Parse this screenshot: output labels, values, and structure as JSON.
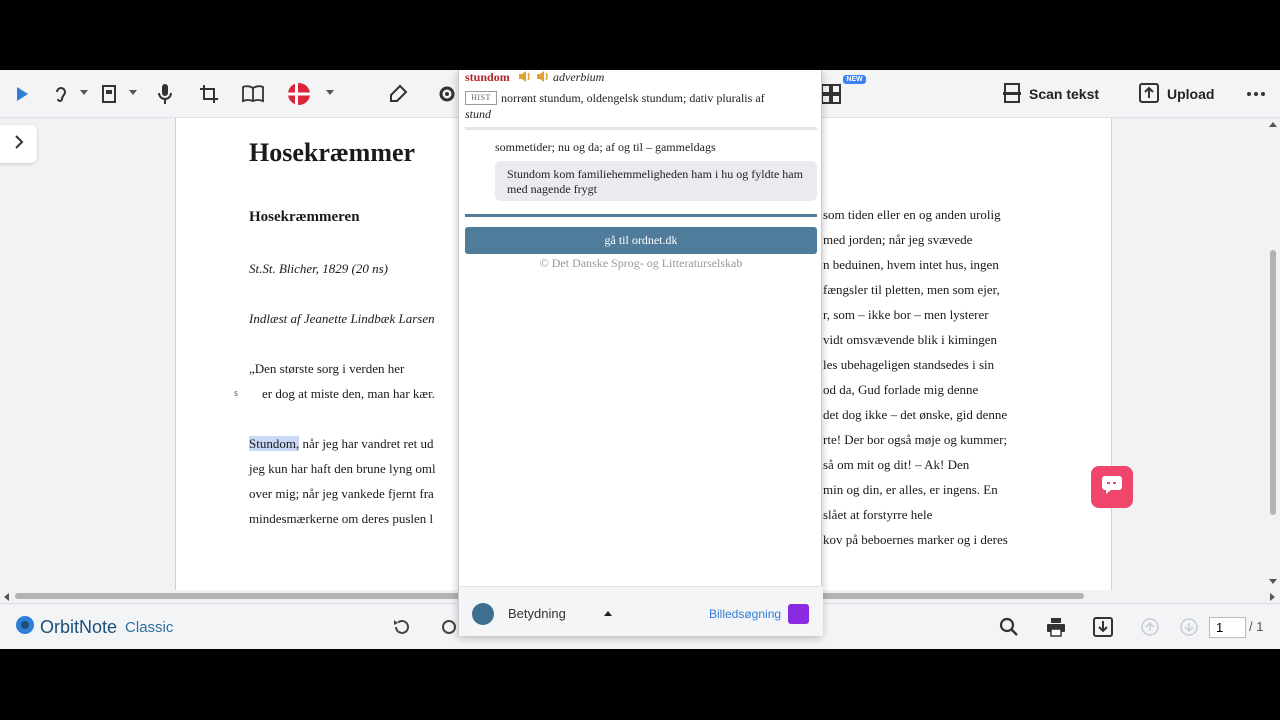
{
  "toolbar": {
    "scan_label": "Scan tekst",
    "upload_label": "Upload",
    "new_badge": "NEW"
  },
  "document": {
    "title": "Hosekræmmer",
    "subtitle": "Hosekræmmeren",
    "author_line": "St.St. Blicher, 1829 (20 ns)",
    "reader_line": "Indlæst af Jeanette Lindbæk Larsen",
    "quote_line1": "„Den største sorg i verden her",
    "quote_marker": "s",
    "quote_line2": "er dog at miste den, man har kær.",
    "highlighted_word": "Stundom,",
    "left_lines": [
      " når jeg har vandret ret ud",
      "jeg kun har haft den brune lyng oml",
      "over mig; når jeg vankede fjernt fra",
      "mindesmærkerne om deres puslen l"
    ],
    "right_lines": [
      "som tiden eller en og anden urolig",
      "med jorden; når jeg svævede",
      "n beduinen, hvem intet hus, ingen",
      "fængsler til pletten, men som ejer,",
      "r, som – ikke bor – men lysterer",
      "vidt omsvævende blik i kimingen",
      "les ubehageligen standsedes i sin",
      "od da, Gud forlade mig denne",
      "det dog ikke – det ønske, gid denne",
      "rte! Der bor også møje og kummer;",
      "så om mit og dit! – Ak! Den",
      "min og din, er alles, er ingens.   En",
      "slået at forstyrre hele",
      "kov på beboernes marker og i deres"
    ]
  },
  "popup": {
    "headword": "stundom",
    "word_class": "adverbium",
    "hist_badge": "HIST",
    "etymology_line1": "norrønt stundum, oldengelsk stundum; dativ pluralis af",
    "etymology_line2": "stund",
    "meaning": "sommetider; nu og da; af og til – gammeldags",
    "example": "Stundom kom familiehemmeligheden ham i hu og fyldte ham med nagende frygt",
    "button_label": "gå til ordnet.dk",
    "copyright": "© Det Danske Sprog- og Litteraturselskab",
    "footer_label": "Betydning",
    "image_search_label": "Billedsøgning"
  },
  "bottombar": {
    "brand_name": "OrbitNote",
    "brand_edition": "Classic",
    "page_value": "1",
    "page_total": "/ 1"
  },
  "colors": {
    "headword": "#b0262c",
    "button": "#4e7c9a",
    "chat": "#f0466c",
    "brand": "#1d4f7a"
  },
  "icons": [
    "play-icon",
    "speech-ear-icon",
    "reading-mode-icon",
    "microphone-icon",
    "crop-icon",
    "book-icon",
    "danish-flag-icon",
    "highlighter-icon",
    "settings-icon",
    "grid-icon",
    "scan-icon",
    "upload-icon",
    "more-icon",
    "chevron-right-icon",
    "search-icon",
    "print-icon",
    "download-icon",
    "arrow-up-icon",
    "arrow-down-icon",
    "chat-icon"
  ]
}
